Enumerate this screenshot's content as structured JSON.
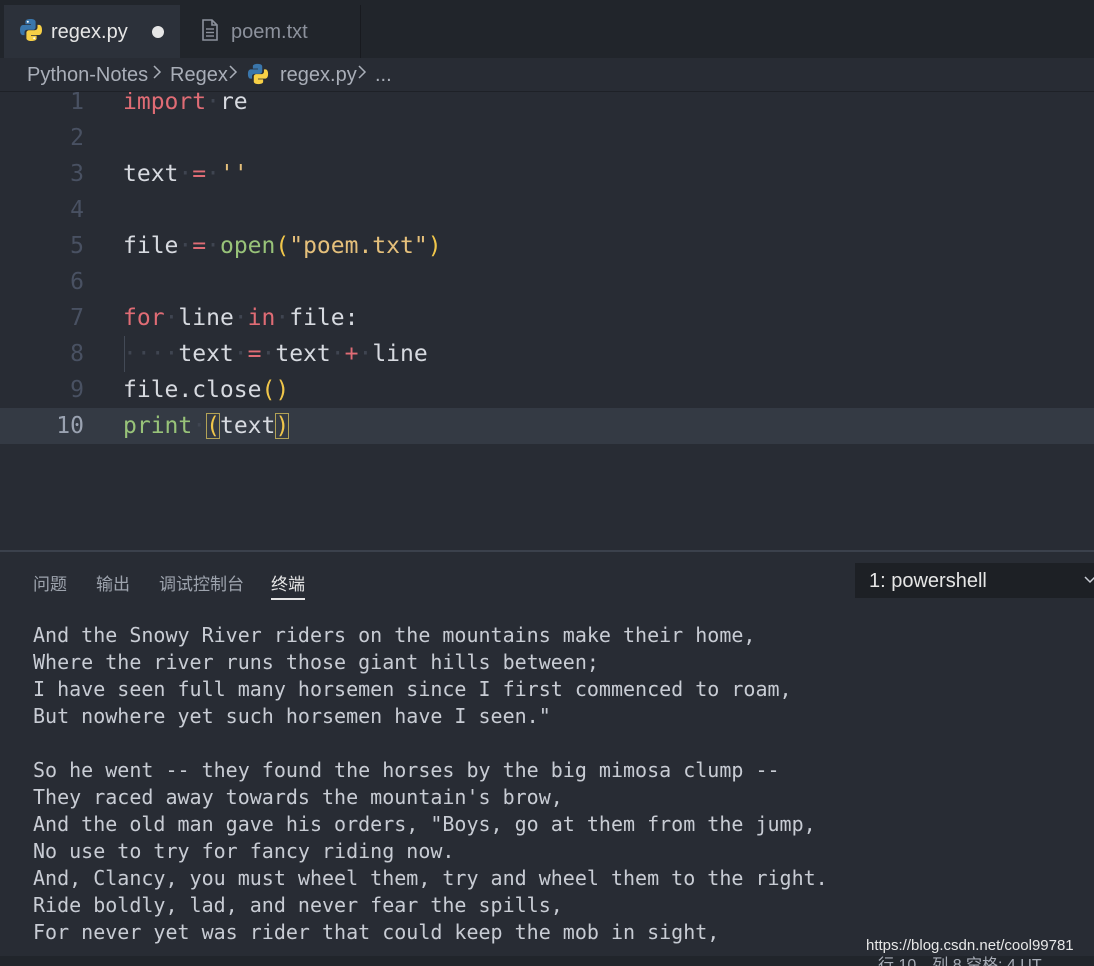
{
  "tabs": [
    {
      "label": "regex.py",
      "icon": "python-file-icon",
      "active": true,
      "modified": true
    },
    {
      "label": "poem.txt",
      "icon": "text-file-icon",
      "active": false,
      "modified": false
    }
  ],
  "breadcrumb": {
    "items": [
      "Python-Notes",
      "Regex",
      "regex.py",
      "..."
    ]
  },
  "editor": {
    "line_numbers": [
      "1",
      "2",
      "3",
      "4",
      "5",
      "6",
      "7",
      "8",
      "9",
      "10"
    ],
    "current_line": "10",
    "tokens": {
      "l1_kw": "import",
      "l1_mod": "re",
      "l3_var": "text",
      "l3_op": "=",
      "l3_str": "''",
      "l5_var": "file",
      "l5_op": "=",
      "l5_fn": "open",
      "l5_open": "(",
      "l5_str": "\"poem.txt\"",
      "l5_close": ")",
      "l7_kw1": "for",
      "l7_var": "line",
      "l7_kw2": "in",
      "l7_rest": "file:",
      "l8_var": "text",
      "l8_op1": "=",
      "l8_var2": "text",
      "l8_op2": "+",
      "l8_var3": "line",
      "l9_call": "file.close",
      "l9_paren": "()",
      "l10_fn": "print",
      "l10_open": "(",
      "l10_arg": "text",
      "l10_close": ")"
    }
  },
  "panel": {
    "tabs": [
      "问题",
      "输出",
      "调试控制台",
      "终端"
    ],
    "active_tab": "终端",
    "terminal_select": "1: powershell",
    "terminal_lines": [
      "And the Snowy River riders on the mountains make their home,",
      "Where the river runs those giant hills between;",
      "I have seen full many horsemen since I first commenced to roam,",
      "But nowhere yet such horsemen have I seen.\"",
      "",
      "So he went -- they found the horses by the big mimosa clump --",
      "They raced away towards the mountain's brow,",
      "And the old man gave his orders, \"Boys, go at them from the jump,",
      "No use to try for fancy riding now.",
      "And, Clancy, you must wheel them, try and wheel them to the right.",
      "Ride boldly, lad, and never fear the spills,",
      "For never yet was rider that could keep the mob in sight,"
    ]
  },
  "watermark": "https://blog.csdn.net/cool99781",
  "statusbar": {
    "text": "行 10，列 8    空格: 4    UT"
  },
  "colors": {
    "background": "#282c34",
    "keyword": "#e06c75",
    "function": "#98c379",
    "string": "#e5c07b",
    "bracket": "#f0c64a",
    "python_icon_blue": "#3a76ab",
    "python_icon_yellow": "#f7d046"
  }
}
